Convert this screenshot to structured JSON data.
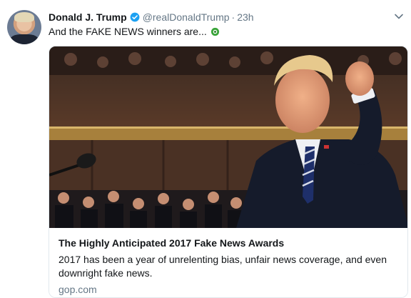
{
  "tweet": {
    "author_name": "Donald J. Trump",
    "handle": "@realDonaldTrump",
    "separator": "·",
    "time": "23h",
    "text": "And the FAKE NEWS winners are...",
    "emoji_icon": "green-circle-emoji-icon"
  },
  "card": {
    "title": "The Highly Anticipated 2017 Fake News Awards",
    "description": "2017 has been a year of unrelenting bias, unfair news coverage, and even downright fake news.",
    "domain": "gop.com"
  },
  "colors": {
    "verified_blue": "#1da1f2",
    "secondary_text": "#657786",
    "border": "#e1e8ed"
  }
}
